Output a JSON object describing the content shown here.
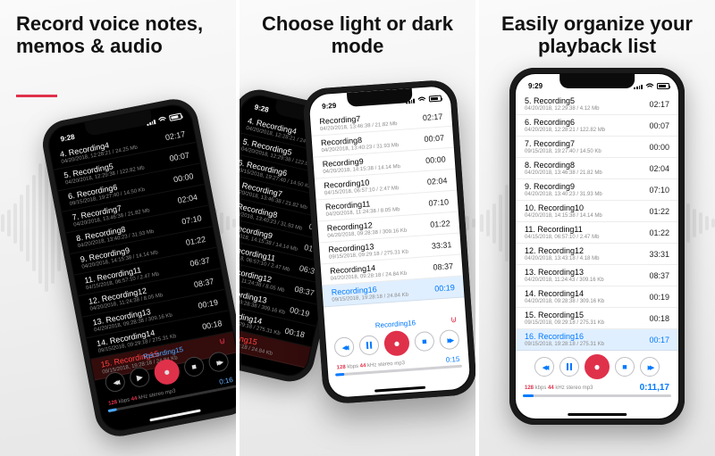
{
  "panels": [
    {
      "headline": "Record voice notes, memos & audio"
    },
    {
      "headline": "Choose light or dark mode"
    },
    {
      "headline": "Easily organize your playback list"
    }
  ],
  "darkPhone": {
    "time": "9:28",
    "rows": [
      {
        "title": "4. Recording4",
        "sub": "04/20/2018, 12:28:21 / 24.25 Mb",
        "dur": "02:17"
      },
      {
        "title": "5. Recording5",
        "sub": "04/20/2018, 12:29:38 / 122.82 Mb",
        "dur": "00:07"
      },
      {
        "title": "6. Recording6",
        "sub": "09/15/2018, 19:27:40 / 14.50 Kb",
        "dur": "00:00"
      },
      {
        "title": "7. Recording7",
        "sub": "04/20/2018, 13:46:38 / 21.82 Mb",
        "dur": "02:04"
      },
      {
        "title": "8. Recording8",
        "sub": "04/20/2018, 13:40:23 / 31.93 Mb",
        "dur": "07:10"
      },
      {
        "title": "9. Recording9",
        "sub": "04/20/2018, 14:15:38 / 14.14 Mb",
        "dur": "01:22"
      },
      {
        "title": "11. Recording11",
        "sub": "04/15/2018, 06:57:10 / 2.47 Mb",
        "dur": "06:37"
      },
      {
        "title": "12. Recording12",
        "sub": "04/20/2018, 11:24:38 / 8.05 Mb",
        "dur": "08:37"
      },
      {
        "title": "13. Recording13",
        "sub": "04/20/2018, 09:28:38 / 309.16 Kb",
        "dur": "00:19"
      },
      {
        "title": "14. Recording14",
        "sub": "09/15/2018, 09:29:18 / 275.31 Kb",
        "dur": "00:18"
      },
      {
        "title": "15. Recording15",
        "sub": "09/15/2018, 19:28:18 / 24.84 Kb",
        "dur": "",
        "selected": true
      }
    ],
    "nowPlaying": "Recording15",
    "format": {
      "kbps": "128",
      "khz": "44",
      "mode": "stereo",
      "codec": "mp3"
    },
    "playTime": "0:16"
  },
  "lightPhoneA": {
    "time": "9:29",
    "rows": [
      {
        "title": "Recording7",
        "sub": "04/20/2018, 13:46:38 / 21.82 Mb",
        "dur": "02:17"
      },
      {
        "title": "Recording8",
        "sub": "04/20/2018, 13:40:23 / 31.93 Mb",
        "dur": "00:07"
      },
      {
        "title": "Recording9",
        "sub": "04/20/2018, 14:15:38 / 14.14 Mb",
        "dur": "00:00"
      },
      {
        "title": "Recording10",
        "sub": "04/15/2018, 06:57:10 / 2.47 Mb",
        "dur": "02:04"
      },
      {
        "title": "Recording11",
        "sub": "04/20/2018, 11:24:38 / 8.05 Mb",
        "dur": "07:10"
      },
      {
        "title": "Recording12",
        "sub": "04/20/2018, 09:28:38 / 309.16 Kb",
        "dur": "01:22"
      },
      {
        "title": "Recording13",
        "sub": "09/15/2018, 09:29:18 / 275.31 Kb",
        "dur": "33:31"
      },
      {
        "title": "Recording14",
        "sub": "04/20/2018, 09:28:18 / 24.84 Kb",
        "dur": "08:37"
      },
      {
        "title": "Recording16",
        "sub": "09/15/2018, 19:28:18 / 24.84 Kb",
        "dur": "00:19",
        "selected": true
      }
    ],
    "nowPlaying": "Recording16",
    "format": {
      "kbps": "128",
      "khz": "44",
      "mode": "stereo",
      "codec": "mp3"
    },
    "playTime": "0:15"
  },
  "lightPhoneB": {
    "time": "9:29",
    "rows": [
      {
        "title": "5. Recording5",
        "sub": "04/20/2018, 12:29:38 / 4.12 Mb",
        "dur": "02:17"
      },
      {
        "title": "6. Recording6",
        "sub": "04/20/2018, 12:28:21 / 122.82 Mb",
        "dur": "00:07"
      },
      {
        "title": "7. Recording7",
        "sub": "09/15/2018, 19:27:40 / 14.50 Kb",
        "dur": "00:00"
      },
      {
        "title": "8. Recording8",
        "sub": "04/20/2018, 13:46:38 / 21.82 Mb",
        "dur": "02:04"
      },
      {
        "title": "9. Recording9",
        "sub": "04/20/2018, 13:40:23 / 31.93 Mb",
        "dur": "07:10"
      },
      {
        "title": "10. Recording10",
        "sub": "04/20/2018, 14:15:38 / 14.14 Mb",
        "dur": "01:22"
      },
      {
        "title": "11. Recording11",
        "sub": "04/15/2018, 06:57:10 / 2.47 Mb",
        "dur": "01:22"
      },
      {
        "title": "12. Recording12",
        "sub": "04/20/2018, 13:43:18 / 4.18 Mb",
        "dur": "33:31"
      },
      {
        "title": "13. Recording13",
        "sub": "04/20/2018, 11:24:43 / 309.16 Kb",
        "dur": "08:37"
      },
      {
        "title": "14. Recording14",
        "sub": "04/20/2018, 09:28:38 / 309.16 Kb",
        "dur": "00:19"
      },
      {
        "title": "15. Recording15",
        "sub": "09/15/2018, 09:29:18 / 275.31 Kb",
        "dur": "00:18"
      },
      {
        "title": "16. Recording16",
        "sub": "09/15/2018, 19:28:18 / 275.31 Kb",
        "dur": "00:17",
        "selected": true
      }
    ],
    "nowPlaying": "",
    "format": {
      "kbps": "128",
      "khz": "44",
      "mode": "stereo",
      "codec": "mp3"
    },
    "playTime": "0:11,17"
  }
}
